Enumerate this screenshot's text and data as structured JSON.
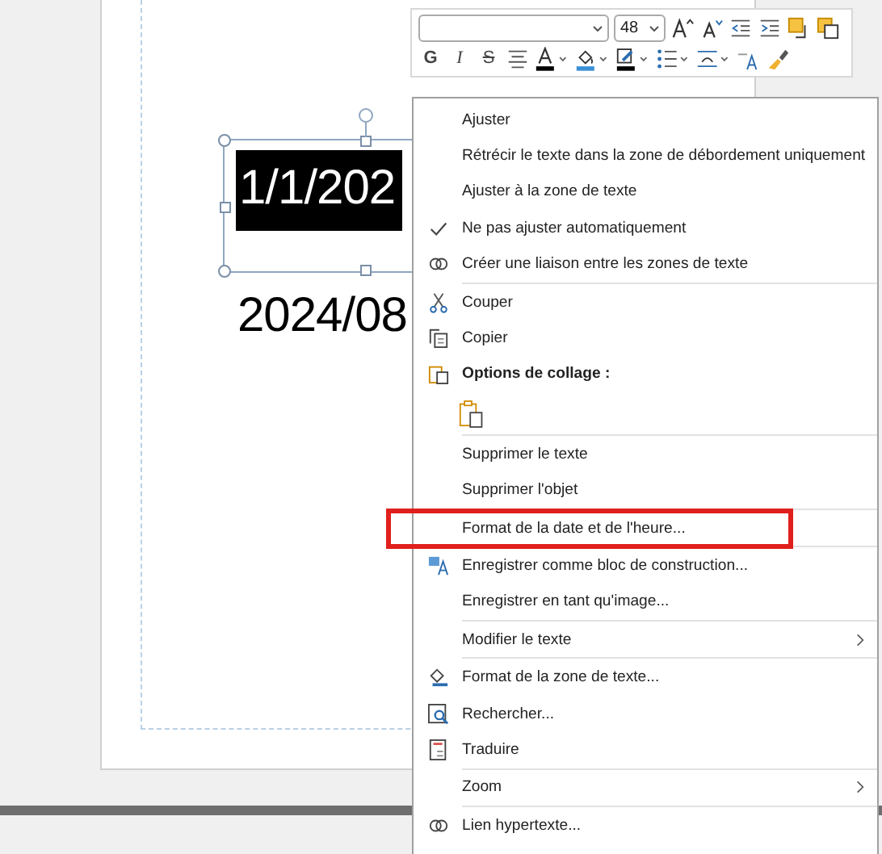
{
  "slide": {
    "date_field": {
      "text": "1/1/202",
      "selected": true
    },
    "date_text": "2024/08"
  },
  "mini_toolbar": {
    "font_size": {
      "value": "48"
    },
    "bold": "G",
    "italic": "I",
    "strike": "S"
  },
  "context_menu": {
    "items": [
      {
        "kind": "item",
        "label": "Ajuster",
        "checked": false,
        "submenu": false,
        "highlighted": false
      },
      {
        "kind": "item",
        "label": "Rétrécir le texte dans la zone de débordement uniquement",
        "checked": false,
        "submenu": false,
        "highlighted": false
      },
      {
        "kind": "item",
        "label": "Ajuster à la zone de texte",
        "checked": false,
        "submenu": false,
        "highlighted": false
      },
      {
        "kind": "item",
        "label": "Ne pas ajuster automatiquement",
        "checked": true,
        "submenu": false,
        "highlighted": false
      },
      {
        "kind": "item",
        "label": "Créer une liaison entre les zones de texte",
        "checked": false,
        "submenu": false,
        "highlighted": false
      },
      {
        "kind": "separator"
      },
      {
        "kind": "item",
        "label": "Couper",
        "checked": false,
        "submenu": false,
        "highlighted": false
      },
      {
        "kind": "item",
        "label": "Copier",
        "checked": false,
        "submenu": false,
        "highlighted": false
      },
      {
        "kind": "header",
        "label": "Options de collage :"
      },
      {
        "kind": "paste"
      },
      {
        "kind": "separator"
      },
      {
        "kind": "item",
        "label": "Supprimer le texte",
        "checked": false,
        "submenu": false,
        "highlighted": false
      },
      {
        "kind": "item",
        "label": "Supprimer l'objet",
        "checked": false,
        "submenu": false,
        "highlighted": false
      },
      {
        "kind": "separator"
      },
      {
        "kind": "item",
        "label": "Format de la date et de l'heure...",
        "checked": false,
        "submenu": false,
        "highlighted": true
      },
      {
        "kind": "separator"
      },
      {
        "kind": "item",
        "label": "Enregistrer comme bloc de construction...",
        "checked": false,
        "submenu": false,
        "highlighted": false
      },
      {
        "kind": "item",
        "label": "Enregistrer en tant qu'image...",
        "checked": false,
        "submenu": false,
        "highlighted": false
      },
      {
        "kind": "separator"
      },
      {
        "kind": "item",
        "label": "Modifier le texte",
        "checked": false,
        "submenu": true,
        "highlighted": false
      },
      {
        "kind": "separator"
      },
      {
        "kind": "item",
        "label": "Format de la zone de texte...",
        "checked": false,
        "submenu": false,
        "highlighted": false
      },
      {
        "kind": "item",
        "label": "Rechercher...",
        "checked": false,
        "submenu": false,
        "highlighted": false
      },
      {
        "kind": "item",
        "label": "Traduire",
        "checked": false,
        "submenu": false,
        "highlighted": false
      },
      {
        "kind": "separator"
      },
      {
        "kind": "item",
        "label": "Zoom",
        "checked": false,
        "submenu": true,
        "highlighted": false
      },
      {
        "kind": "separator"
      },
      {
        "kind": "item",
        "label": "Lien hypertexte...",
        "checked": false,
        "submenu": false,
        "highlighted": false
      }
    ]
  }
}
